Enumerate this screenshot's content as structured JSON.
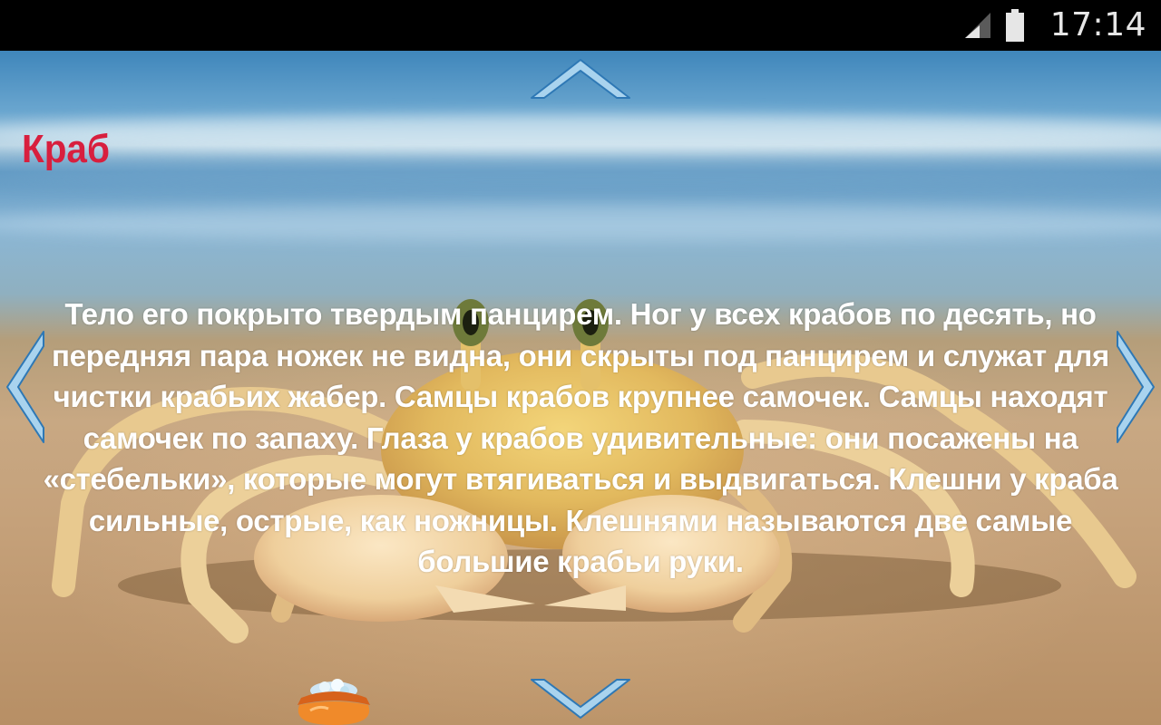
{
  "status_bar": {
    "time": "17:14",
    "icons": [
      "signal-icon",
      "battery-icon"
    ]
  },
  "page": {
    "title": "Краб",
    "body": "Тело его покрыто твердым панцирем. Ног у всех крабов по десять, но передняя пара ножек не видна, они скрыты под панцирем и служат для чистки крабьих жабер. Самцы крабов крупнее самочек. Самцы находят самочек по запаху. Глаза у крабов удивительные: они посажены на «стебельки», которые могут втягиваться и выдвигаться. Клешни у краба сильные, острые, как ножницы. Клешнями называются две самые большие крабьи руки."
  },
  "navigation": {
    "icons": [
      "chevron-up-icon",
      "chevron-down-icon",
      "chevron-left-icon",
      "chevron-right-icon"
    ]
  },
  "colors": {
    "title": "#d81f3e",
    "text": "#ffffff",
    "arrow_fill": "#a9d3ee",
    "arrow_stroke": "#2e78b5",
    "status_bar": "#000000"
  },
  "decor": {
    "background_image": "crab-on-beach",
    "pot_icon": "honey-pot-icon"
  }
}
